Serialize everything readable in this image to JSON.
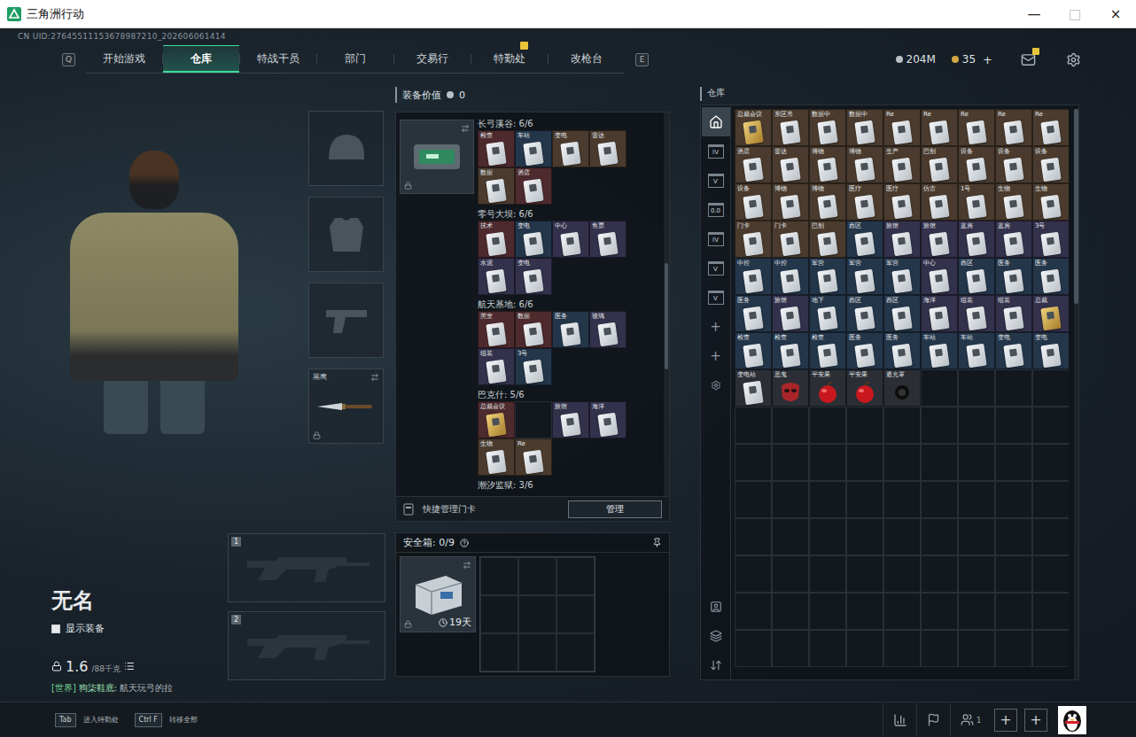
{
  "window": {
    "title": "三角洲行动",
    "controls": [
      "—",
      "□",
      "×"
    ]
  },
  "uid": "CN UID:27645511153678987210_202606061414",
  "nav": {
    "prev_key": "Q",
    "next_key": "E",
    "tabs": [
      {
        "label": "开始游戏",
        "selected": false,
        "badge": false
      },
      {
        "label": "仓库",
        "selected": true,
        "badge": false
      },
      {
        "label": "特战干员",
        "selected": false,
        "badge": false
      },
      {
        "label": "部门",
        "selected": false,
        "badge": false
      },
      {
        "label": "交易行",
        "selected": false,
        "badge": false
      },
      {
        "label": "特勤处",
        "selected": false,
        "badge": true
      },
      {
        "label": "改枪台",
        "selected": false,
        "badge": false
      }
    ],
    "currency": [
      {
        "value": "204M",
        "color": "#b9c0c6"
      },
      {
        "value": "35",
        "color": "#d4a942"
      }
    ],
    "add": "+",
    "mail_badge": true
  },
  "player": {
    "name": "无名",
    "show_equipment": {
      "label": "显示装备",
      "checked": false
    },
    "weight": {
      "value": "1.6",
      "max": "/88千克"
    },
    "chat": {
      "channel": "[世界]",
      "sender": "狗柒鞋底:",
      "message": "航天玩弓的拉"
    }
  },
  "equipment_slots": [
    {
      "kind": "helmet",
      "label": ""
    },
    {
      "kind": "armor",
      "label": ""
    },
    {
      "kind": "pistol",
      "label": ""
    },
    {
      "kind": "knife",
      "label": "黑鹰"
    }
  ],
  "weapon_slots": [
    {
      "label": "1"
    },
    {
      "label": "2"
    }
  ],
  "equipment_value": {
    "label": "装备价值",
    "value": "0"
  },
  "keycards": {
    "groups": [
      {
        "title": "长弓溪谷: 6/6",
        "items": [
          {
            "kind": "card",
            "label": "检查",
            "color": "#4d2a2e"
          },
          {
            "kind": "card",
            "label": "车站",
            "color": "#24364a"
          },
          {
            "kind": "card",
            "label": "变电",
            "color": "#4a3b2e"
          },
          {
            "kind": "card",
            "label": "雷达",
            "color": "#4a3b2e"
          },
          {
            "kind": "card",
            "label": "数据",
            "color": "#4a3b2e"
          },
          {
            "kind": "card",
            "label": "酒店",
            "color": "#4d2a2e"
          }
        ]
      },
      {
        "title": "零号大坝: 6/6",
        "items": [
          {
            "kind": "card",
            "label": "技术",
            "color": "#4d2a2e"
          },
          {
            "kind": "card",
            "label": "变电",
            "color": "#24364a"
          },
          {
            "kind": "card",
            "label": "中心",
            "color": "#33314b"
          },
          {
            "kind": "card",
            "label": "售票",
            "color": "#33314b"
          },
          {
            "kind": "card",
            "label": "水泥",
            "color": "#33314b"
          },
          {
            "kind": "card",
            "label": "变电",
            "color": "#33314b"
          }
        ]
      },
      {
        "title": "航天基地: 6/6",
        "items": [
          {
            "kind": "card",
            "label": "黑室",
            "color": "#4d2a2e"
          },
          {
            "kind": "card",
            "label": "数据",
            "color": "#4d2a2e"
          },
          {
            "kind": "card",
            "label": "医务",
            "color": "#24364a"
          },
          {
            "kind": "card",
            "label": "玻璃",
            "color": "#33314b"
          },
          {
            "kind": "card",
            "label": "组装",
            "color": "#33314b"
          },
          {
            "kind": "card",
            "label": "3号",
            "color": "#24364a"
          }
        ]
      },
      {
        "title": "巴克什: 5/6",
        "items": [
          {
            "kind": "gold-card",
            "label": "总裁会议",
            "color": "#4d2a2e"
          },
          {
            "kind": "empty",
            "label": "",
            "color": "#1a2026"
          },
          {
            "kind": "card",
            "label": "旅馆",
            "color": "#33314b"
          },
          {
            "kind": "card",
            "label": "海洋",
            "color": "#33314b"
          },
          {
            "kind": "card",
            "label": "生物",
            "color": "#4a3b2e"
          },
          {
            "kind": "card",
            "label": "Re",
            "color": "#4a3b2e"
          }
        ]
      },
      {
        "title": "潮汐监狱: 3/6",
        "items": []
      }
    ],
    "manage_label": "快捷管理门卡",
    "manage_button": "管理"
  },
  "safebox": {
    "label": "安全箱: 0/9",
    "days": "19天",
    "slots": 9
  },
  "warehouse": {
    "title": "仓库",
    "side_tabs": [
      {
        "kind": "home",
        "label": "",
        "selected": true
      },
      {
        "kind": "shelf",
        "label": "IV",
        "selected": false
      },
      {
        "kind": "shelf",
        "label": "V",
        "selected": false
      },
      {
        "kind": "shelf",
        "label": "0.0",
        "selected": false
      },
      {
        "kind": "shelf",
        "label": "IV",
        "selected": false
      },
      {
        "kind": "shelf",
        "label": "V",
        "selected": false
      },
      {
        "kind": "shelf",
        "label": "V",
        "selected": false
      },
      {
        "kind": "plus",
        "label": "+",
        "selected": false
      },
      {
        "kind": "plus",
        "label": "+",
        "selected": false
      },
      {
        "kind": "gear",
        "label": "",
        "selected": false
      }
    ],
    "tools": [
      {
        "kind": "person"
      },
      {
        "kind": "layers"
      },
      {
        "kind": "sort"
      }
    ],
    "items": [
      {
        "kind": "gold-card",
        "label": "总裁会议",
        "color": "#4a3b2e"
      },
      {
        "kind": "card",
        "label": "东区吊",
        "color": "#4a3b2e"
      },
      {
        "kind": "card",
        "label": "数据中",
        "color": "#4a3b2e"
      },
      {
        "kind": "card",
        "label": "数据中",
        "color": "#4a3b2e"
      },
      {
        "kind": "card",
        "label": "Re",
        "color": "#4a3b2e"
      },
      {
        "kind": "card",
        "label": "Re",
        "color": "#4a3b2e"
      },
      {
        "kind": "card",
        "label": "Re",
        "color": "#4a3b2e"
      },
      {
        "kind": "card",
        "label": "Re",
        "color": "#4a3b2e"
      },
      {
        "kind": "card",
        "label": "Re",
        "color": "#4a3b2e"
      },
      {
        "kind": "card",
        "label": "酒店",
        "color": "#4a3b2e"
      },
      {
        "kind": "card",
        "label": "雷达",
        "color": "#4a3b2e"
      },
      {
        "kind": "card",
        "label": "博物",
        "color": "#4a3b2e"
      },
      {
        "kind": "card",
        "label": "博物",
        "color": "#4a3b2e"
      },
      {
        "kind": "card",
        "label": "生产",
        "color": "#4a3b2e"
      },
      {
        "kind": "card",
        "label": "巴别",
        "color": "#4a3b2e"
      },
      {
        "kind": "card",
        "label": "设备",
        "color": "#4a3b2e"
      },
      {
        "kind": "card",
        "label": "设备",
        "color": "#4a3b2e"
      },
      {
        "kind": "card",
        "label": "设备",
        "color": "#4a3b2e"
      },
      {
        "kind": "card",
        "label": "设备",
        "color": "#4a3b2e"
      },
      {
        "kind": "card",
        "label": "博物",
        "color": "#4a3b2e"
      },
      {
        "kind": "card",
        "label": "博物",
        "color": "#4a3b2e"
      },
      {
        "kind": "card",
        "label": "医疗",
        "color": "#4a3b2e"
      },
      {
        "kind": "card",
        "label": "医疗",
        "color": "#4a3b2e"
      },
      {
        "kind": "card",
        "label": "仿古",
        "color": "#4a3b2e"
      },
      {
        "kind": "card",
        "label": "1号",
        "color": "#4a3b2e"
      },
      {
        "kind": "card",
        "label": "生物",
        "color": "#4a3b2e"
      },
      {
        "kind": "card",
        "label": "生物",
        "color": "#4a3b2e"
      },
      {
        "kind": "card",
        "label": "门卡",
        "color": "#4a3b2e"
      },
      {
        "kind": "card",
        "label": "门卡",
        "color": "#4a3b2e"
      },
      {
        "kind": "card",
        "label": "巴别",
        "color": "#4a3b2e"
      },
      {
        "kind": "card",
        "label": "西区",
        "color": "#24364a"
      },
      {
        "kind": "card",
        "label": "旅馆",
        "color": "#33314b"
      },
      {
        "kind": "card",
        "label": "旅馆",
        "color": "#33314b"
      },
      {
        "kind": "card",
        "label": "蓝房",
        "color": "#33314b"
      },
      {
        "kind": "card",
        "label": "蓝房",
        "color": "#33314b"
      },
      {
        "kind": "card",
        "label": "3号",
        "color": "#33314b"
      },
      {
        "kind": "card",
        "label": "中控",
        "color": "#24364a"
      },
      {
        "kind": "card",
        "label": "中控",
        "color": "#24364a"
      },
      {
        "kind": "card",
        "label": "军营",
        "color": "#24364a"
      },
      {
        "kind": "card",
        "label": "军营",
        "color": "#24364a"
      },
      {
        "kind": "card",
        "label": "军营",
        "color": "#24364a"
      },
      {
        "kind": "card",
        "label": "中心",
        "color": "#33314b"
      },
      {
        "kind": "card",
        "label": "西区",
        "color": "#24364a"
      },
      {
        "kind": "card",
        "label": "医务",
        "color": "#24364a"
      },
      {
        "kind": "card",
        "label": "医务",
        "color": "#24364a"
      },
      {
        "kind": "card",
        "label": "医务",
        "color": "#24364a"
      },
      {
        "kind": "card",
        "label": "旅馆",
        "color": "#33314b"
      },
      {
        "kind": "card",
        "label": "地下",
        "color": "#24364a"
      },
      {
        "kind": "card",
        "label": "西区",
        "color": "#24364a"
      },
      {
        "kind": "card",
        "label": "西区",
        "color": "#24364a"
      },
      {
        "kind": "card",
        "label": "海洋",
        "color": "#33314b"
      },
      {
        "kind": "card",
        "label": "组装",
        "color": "#33314b"
      },
      {
        "kind": "card",
        "label": "组装",
        "color": "#33314b"
      },
      {
        "kind": "gold-card",
        "label": "总裁",
        "color": "#33314b"
      },
      {
        "kind": "card",
        "label": "检查",
        "color": "#24364a"
      },
      {
        "kind": "card",
        "label": "检查",
        "color": "#24364a"
      },
      {
        "kind": "card",
        "label": "检查",
        "color": "#24364a"
      },
      {
        "kind": "card",
        "label": "医务",
        "color": "#24364a"
      },
      {
        "kind": "card",
        "label": "医务",
        "color": "#24364a"
      },
      {
        "kind": "card",
        "label": "车站",
        "color": "#24364a"
      },
      {
        "kind": "card",
        "label": "车站",
        "color": "#24364a"
      },
      {
        "kind": "card",
        "label": "变电",
        "color": "#24364a"
      },
      {
        "kind": "card",
        "label": "变电",
        "color": "#24364a"
      },
      {
        "kind": "card",
        "label": "变电站",
        "color": "#2b2f35"
      },
      {
        "kind": "mask",
        "label": "恶鬼",
        "color": "#2b2f35"
      },
      {
        "kind": "apple",
        "label": "平安果",
        "color": "#2b2f35"
      },
      {
        "kind": "apple",
        "label": "平安果",
        "color": "#2b2f35"
      },
      {
        "kind": "hood",
        "label": "遮光罩",
        "color": "#2b2f35"
      }
    ]
  },
  "bottom_bar": {
    "hints": [
      {
        "key": "Tab",
        "label": "进入特勤处"
      },
      {
        "key": "Ctrl F",
        "label": "转移全部"
      }
    ],
    "squad_count": "1",
    "invite_slots": [
      "+",
      "+"
    ]
  }
}
